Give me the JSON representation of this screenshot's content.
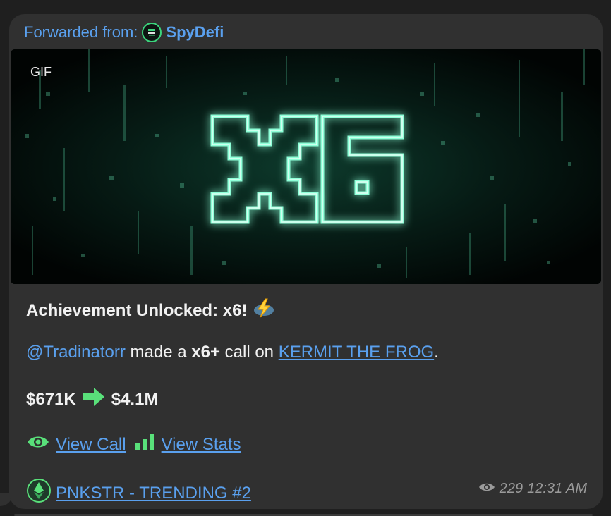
{
  "forward": {
    "prefix": "Forwarded from:",
    "channel_name": "SpyDefi",
    "avatar_icon": "spydefi-logo"
  },
  "media": {
    "badge": "GIF",
    "content_text": "x6"
  },
  "message": {
    "title": "Achievement Unlocked: x6!",
    "title_icon": "lightning-emoji",
    "mention": "@Tradinatorr",
    "text_a": " made a ",
    "bold_mult": "x6+",
    "text_b": " call on ",
    "token_link": "KERMIT THE FROG",
    "period": ".",
    "price_from": "$671K",
    "arrow_icon": "green-right-arrow",
    "price_to": "$4.1M",
    "view_call_icon": "eye-icon",
    "view_call": "View Call",
    "stats_icon": "bar-chart-icon",
    "view_stats": "View Stats",
    "eth_icon": "ethereum-icon",
    "trending_link": "PNKSTR - TRENDING #2"
  },
  "meta": {
    "views_icon": "views-eye-icon",
    "views": "229",
    "time": "12:31 AM"
  },
  "colors": {
    "bubble": "#303030",
    "link": "#5aa0ee",
    "accent_green": "#59e07a",
    "glow": "#6dffd0"
  }
}
